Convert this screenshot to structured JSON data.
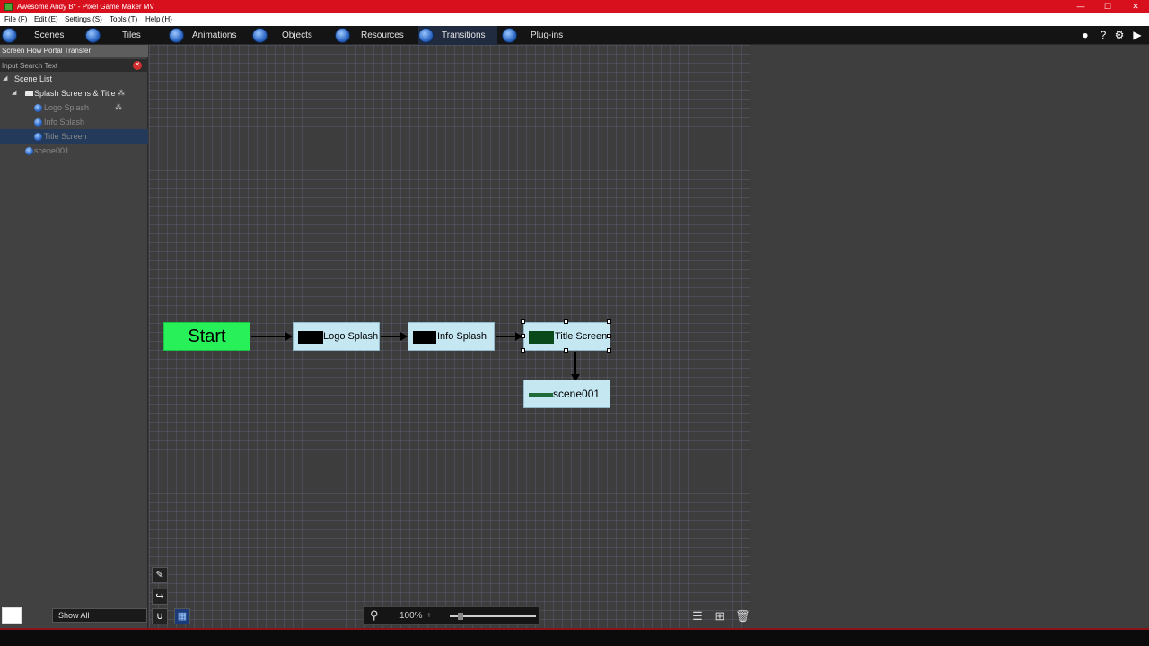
{
  "window": {
    "title": "Awesome Andy B* - Pixel Game Maker MV",
    "minimize": "—",
    "maximize": "☐",
    "close": "✕"
  },
  "menu": {
    "file": "File (F)",
    "edit": "Edit (E)",
    "settings": "Settings (S)",
    "tools": "Tools (T)",
    "help": "Help (H)"
  },
  "tabs": [
    {
      "label": "Scenes"
    },
    {
      "label": "Tiles"
    },
    {
      "label": "Animations"
    },
    {
      "label": "Objects"
    },
    {
      "label": "Resources"
    },
    {
      "label": "Transitions"
    },
    {
      "label": "Plug-ins"
    }
  ],
  "active_tab": "Transitions",
  "left_panel": {
    "header": "Screen Flow  Portal Transfer",
    "search_placeholder": "Input Search Text",
    "scene_list_label": "Scene List",
    "folder_label": "Splash Screens & Title",
    "items": [
      {
        "label": "Logo Splash"
      },
      {
        "label": "Info Splash"
      },
      {
        "label": "Title Screen"
      },
      {
        "label": "scene001"
      }
    ],
    "show_all": "Show All"
  },
  "flow": {
    "start": "Start",
    "nodes": [
      {
        "label": "Logo Splash"
      },
      {
        "label": "Info Splash"
      },
      {
        "label": "Title Screen"
      },
      {
        "label": "scene001"
      }
    ]
  },
  "zoom": {
    "value": "100%",
    "plus": "+"
  },
  "colors": {
    "titlebar": "#d8101e",
    "start_node": "#28f058",
    "scene_node": "#c5e7f2",
    "selected_row": "#243a5a"
  }
}
